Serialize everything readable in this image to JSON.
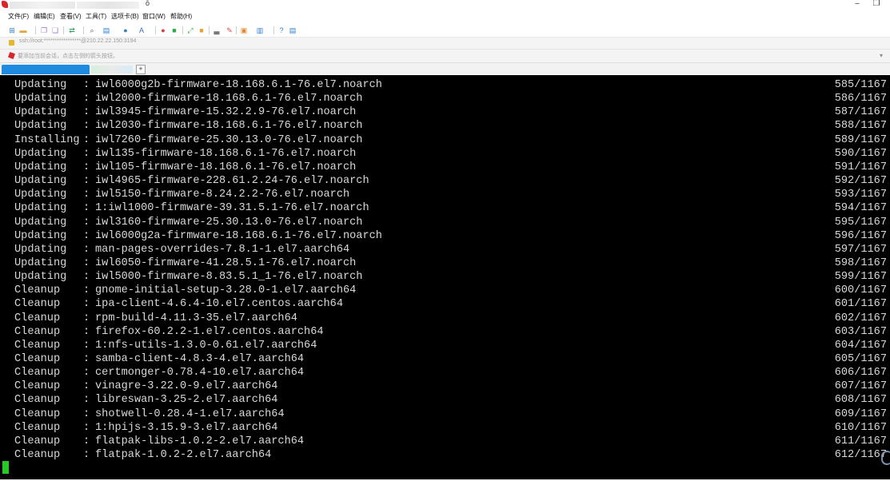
{
  "titlebar": {
    "suffix": "ō",
    "minimize_glyph": "–",
    "restore_glyph": "❐"
  },
  "menu": [
    "文件(F)",
    "编辑(E)",
    "查看(V)",
    "工具(T)",
    "选项卡(B)",
    "窗口(W)",
    "帮助(H)"
  ],
  "toolbar_icons": [
    {
      "name": "new-session-icon",
      "glyph": "⊞",
      "color": "#2a7fd0"
    },
    {
      "name": "open-folder-icon",
      "glyph": "▬",
      "color": "#e2a33a"
    },
    {
      "name": "copy-icon",
      "glyph": "❐",
      "color": "#9a6fd0"
    },
    {
      "name": "paste-icon",
      "glyph": "❑",
      "color": "#9a6fd0"
    },
    {
      "name": "transfer-icon",
      "glyph": "⇄",
      "color": "#2e9f5a"
    },
    {
      "name": "find-icon",
      "glyph": "⌕",
      "color": "#555555"
    },
    {
      "name": "properties-icon",
      "glyph": "▤",
      "color": "#2a7fd0"
    },
    {
      "name": "globe-icon",
      "glyph": "●",
      "color": "#2a84c8"
    },
    {
      "name": "keyboard-icon",
      "glyph": "A",
      "color": "#3a6fb5"
    },
    {
      "name": "stop-icon",
      "glyph": "●",
      "color": "#d43a3a"
    },
    {
      "name": "record-icon",
      "glyph": "■",
      "color": "#2eaa4a"
    },
    {
      "name": "fullscreen-icon",
      "glyph": "⤢",
      "color": "#2eaa4a"
    },
    {
      "name": "lock-screen-icon",
      "glyph": "■",
      "color": "#e2a33a"
    },
    {
      "name": "compose-icon",
      "glyph": "▃",
      "color": "#777777"
    },
    {
      "name": "script-icon",
      "glyph": "✎",
      "color": "#d44a4a"
    },
    {
      "name": "layout-icon",
      "glyph": "▣",
      "color": "#e28a2a"
    },
    {
      "name": "tile-icon",
      "glyph": "▥",
      "color": "#2a7fd0"
    },
    {
      "name": "help-icon",
      "glyph": "?",
      "color": "#2a7fd0"
    },
    {
      "name": "chat-icon",
      "glyph": "▤",
      "color": "#2a7fd0"
    }
  ],
  "address": {
    "text": "ssh://root:*****************@210.22.22.150:3194"
  },
  "hint": {
    "text": "要添加当前会话，点击左侧的箭头按钮。",
    "arrow_glyph": "▾"
  },
  "tabs": {
    "add_glyph": "+"
  },
  "terminal": {
    "lines": [
      {
        "action": "Updating",
        "package": "iwl6000g2b-firmware-18.168.6.1-76.el7.noarch",
        "counter": "585/1167"
      },
      {
        "action": "Updating",
        "package": "iwl2000-firmware-18.168.6.1-76.el7.noarch",
        "counter": "586/1167"
      },
      {
        "action": "Updating",
        "package": "iwl3945-firmware-15.32.2.9-76.el7.noarch",
        "counter": "587/1167"
      },
      {
        "action": "Updating",
        "package": "iwl2030-firmware-18.168.6.1-76.el7.noarch",
        "counter": "588/1167"
      },
      {
        "action": "Installing",
        "package": "iwl7260-firmware-25.30.13.0-76.el7.noarch",
        "counter": "589/1167"
      },
      {
        "action": "Updating",
        "package": "iwl135-firmware-18.168.6.1-76.el7.noarch",
        "counter": "590/1167"
      },
      {
        "action": "Updating",
        "package": "iwl105-firmware-18.168.6.1-76.el7.noarch",
        "counter": "591/1167"
      },
      {
        "action": "Updating",
        "package": "iwl4965-firmware-228.61.2.24-76.el7.noarch",
        "counter": "592/1167"
      },
      {
        "action": "Updating",
        "package": "iwl5150-firmware-8.24.2.2-76.el7.noarch",
        "counter": "593/1167"
      },
      {
        "action": "Updating",
        "package": "1:iwl1000-firmware-39.31.5.1-76.el7.noarch",
        "counter": "594/1167"
      },
      {
        "action": "Updating",
        "package": "iwl3160-firmware-25.30.13.0-76.el7.noarch",
        "counter": "595/1167"
      },
      {
        "action": "Updating",
        "package": "iwl6000g2a-firmware-18.168.6.1-76.el7.noarch",
        "counter": "596/1167"
      },
      {
        "action": "Updating",
        "package": "man-pages-overrides-7.8.1-1.el7.aarch64",
        "counter": "597/1167"
      },
      {
        "action": "Updating",
        "package": "iwl6050-firmware-41.28.5.1-76.el7.noarch",
        "counter": "598/1167"
      },
      {
        "action": "Updating",
        "package": "iwl5000-firmware-8.83.5.1_1-76.el7.noarch",
        "counter": "599/1167"
      },
      {
        "action": "Cleanup",
        "package": "gnome-initial-setup-3.28.0-1.el7.aarch64",
        "counter": "600/1167"
      },
      {
        "action": "Cleanup",
        "package": "ipa-client-4.6.4-10.el7.centos.aarch64",
        "counter": "601/1167"
      },
      {
        "action": "Cleanup",
        "package": "rpm-build-4.11.3-35.el7.aarch64",
        "counter": "602/1167"
      },
      {
        "action": "Cleanup",
        "package": "firefox-60.2.2-1.el7.centos.aarch64",
        "counter": "603/1167"
      },
      {
        "action": "Cleanup",
        "package": "1:nfs-utils-1.3.0-0.61.el7.aarch64",
        "counter": "604/1167"
      },
      {
        "action": "Cleanup",
        "package": "samba-client-4.8.3-4.el7.aarch64",
        "counter": "605/1167"
      },
      {
        "action": "Cleanup",
        "package": "certmonger-0.78.4-10.el7.aarch64",
        "counter": "606/1167"
      },
      {
        "action": "Cleanup",
        "package": "vinagre-3.22.0-9.el7.aarch64",
        "counter": "607/1167"
      },
      {
        "action": "Cleanup",
        "package": "libreswan-3.25-2.el7.aarch64",
        "counter": "608/1167"
      },
      {
        "action": "Cleanup",
        "package": "shotwell-0.28.4-1.el7.aarch64",
        "counter": "609/1167"
      },
      {
        "action": "Cleanup",
        "package": "1:hpijs-3.15.9-3.el7.aarch64",
        "counter": "610/1167"
      },
      {
        "action": "Cleanup",
        "package": "flatpak-libs-1.0.2-2.el7.aarch64",
        "counter": "611/1167"
      },
      {
        "action": "Cleanup",
        "package": "flatpak-1.0.2-2.el7.aarch64",
        "counter": "612/1167"
      }
    ],
    "separator": ":",
    "colors": {
      "background": "#000000",
      "text": "#d8d8d8",
      "cursor": "#22cc22"
    }
  }
}
